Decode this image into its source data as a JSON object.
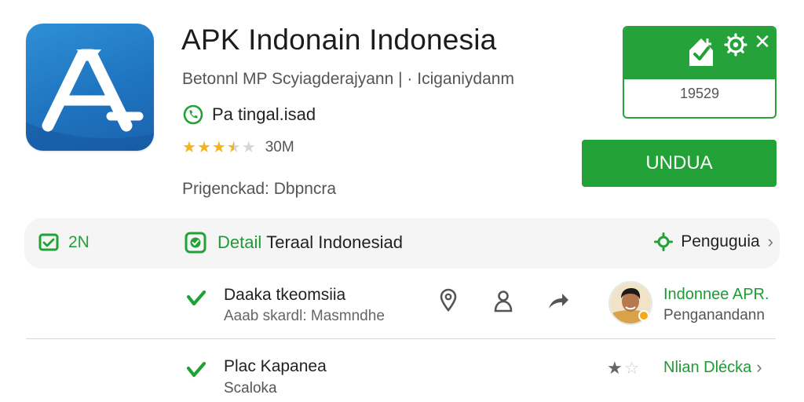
{
  "header": {
    "title": "APK Indonain Indonesia",
    "subtitle": "Betonnl MP Scyiagderajyann | · Iciganiydanm",
    "category": {
      "label": "Pa tingal.isad",
      "icon": "phone-circle-icon"
    },
    "rating": {
      "stars": 3.5,
      "count": "30M"
    },
    "developer": "Prigenckad: Dbpncra",
    "icon": "app-store-a-icon"
  },
  "install_card": {
    "icons": [
      "home-install-icon",
      "gear-icon",
      "close-icon"
    ],
    "size": "19529"
  },
  "download_button": {
    "label": "UNDUA"
  },
  "tabs": {
    "left": {
      "icon": "message-icon",
      "count": "2N"
    },
    "detail": {
      "icon": "chat-icon",
      "label_green": "Detail",
      "label_dark": "Teraal Indonesiad"
    },
    "right": {
      "icon": "settings-spark-icon",
      "label": "Penguguia"
    }
  },
  "rows": [
    {
      "title": "Daaka tkeomsiia",
      "subtitle": "Aaab skardl: Masmndhe",
      "actions": [
        "location-pin-icon",
        "person-icon",
        "share-icon"
      ],
      "right_title": "Indonnee APR.",
      "right_subtitle": "Penganandann"
    },
    {
      "title": "Plac Kapanea",
      "subtitle": "Scaloka",
      "stars": 1,
      "right_label": "Nlian Dlécka"
    }
  ],
  "colors": {
    "brand_green": "#22a137",
    "app_blue": "#1f74c0",
    "star": "#f3b51b"
  }
}
